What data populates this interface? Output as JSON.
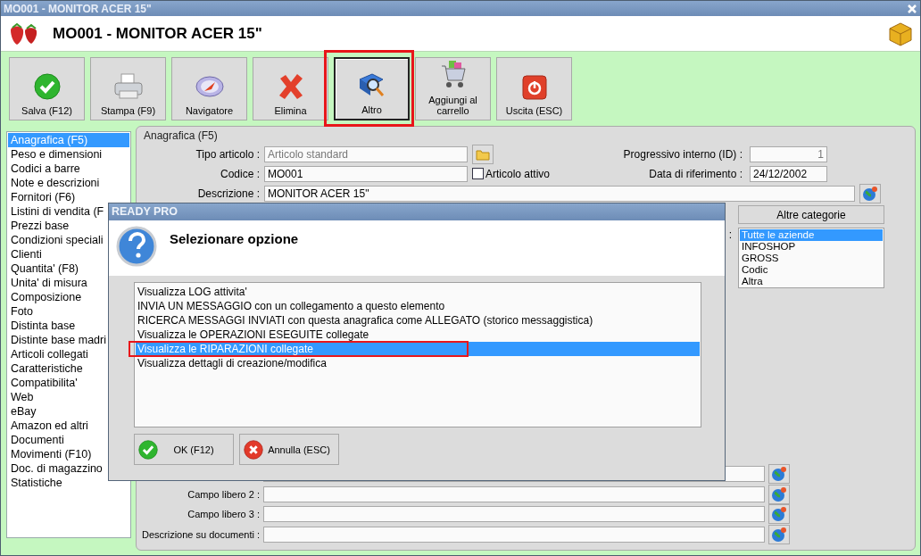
{
  "window": {
    "title": "MO001 - MONITOR ACER 15\""
  },
  "header": {
    "title": "MO001 - MONITOR ACER 15\""
  },
  "toolbar": [
    {
      "label": "Salva (F12)",
      "selected": false
    },
    {
      "label": "Stampa (F9)",
      "selected": false
    },
    {
      "label": "Navigatore",
      "selected": false
    },
    {
      "label": "Elimina",
      "selected": false
    },
    {
      "label": "Altro",
      "selected": true,
      "highlighted": true
    },
    {
      "label": "Aggiungi al carrello",
      "selected": false
    },
    {
      "label": "Uscita (ESC)",
      "selected": false
    }
  ],
  "sidebar": {
    "items": [
      {
        "label": "Anagrafica (F5)",
        "selected": true
      },
      {
        "label": "Peso e dimensioni",
        "selected": false
      },
      {
        "label": "Codici a barre",
        "selected": false
      },
      {
        "label": "Note e descrizioni",
        "selected": false
      },
      {
        "label": "Fornitori (F6)",
        "selected": false
      },
      {
        "label": "Listini di vendita (F",
        "selected": false
      },
      {
        "label": "Prezzi base",
        "selected": false
      },
      {
        "label": "Condizioni speciali",
        "selected": false
      },
      {
        "label": "Clienti",
        "selected": false
      },
      {
        "label": "Quantita' (F8)",
        "selected": false
      },
      {
        "label": "Unita' di misura",
        "selected": false
      },
      {
        "label": "Composizione",
        "selected": false
      },
      {
        "label": "Foto",
        "selected": false
      },
      {
        "label": "Distinta base",
        "selected": false
      },
      {
        "label": "Distinte base madri",
        "selected": false
      },
      {
        "label": "Articoli collegati",
        "selected": false
      },
      {
        "label": "Caratteristiche",
        "selected": false
      },
      {
        "label": "Compatibilita'",
        "selected": false
      },
      {
        "label": "Web",
        "selected": false
      },
      {
        "label": "eBay",
        "selected": false
      },
      {
        "label": "Amazon ed altri",
        "selected": false
      },
      {
        "label": "Documenti",
        "selected": false
      },
      {
        "label": "Movimenti (F10)",
        "selected": false
      },
      {
        "label": "Doc. di magazzino",
        "selected": false
      },
      {
        "label": "Statistiche",
        "selected": false
      }
    ]
  },
  "form": {
    "legend": "Anagrafica (F5)",
    "tipo_articolo": {
      "label": "Tipo articolo :",
      "value": "Articolo standard",
      "disabled": true
    },
    "codice": {
      "label": "Codice :",
      "value": "MO001"
    },
    "articolo_attivo": {
      "label": "Articolo attivo",
      "checked": false
    },
    "progressivo": {
      "label": "Progressivo interno (ID) :",
      "value": "1",
      "disabled": true
    },
    "data_riferimento": {
      "label": "Data di riferimento :",
      "value": "24/12/2002"
    },
    "descrizione": {
      "label": "Descrizione :",
      "value": "MONITOR ACER 15\""
    },
    "altre_categorie_button": "Altre categorie",
    "companies_colon": ":",
    "companies": [
      {
        "label": "Tutte le aziende",
        "selected": true
      },
      {
        "label": "INFOSHOP",
        "selected": false
      },
      {
        "label": "GROSS",
        "selected": false
      },
      {
        "label": "Codic",
        "selected": false
      },
      {
        "label": "Altra",
        "selected": false
      }
    ],
    "extra_fields": [
      {
        "label": "Campo libero 2 :"
      },
      {
        "label": "Campo libero 3 :"
      },
      {
        "label": "Descrizione su documenti :"
      }
    ]
  },
  "dialog": {
    "title": "READY PRO",
    "heading": "Selezionare opzione",
    "options": [
      {
        "label": "Visualizza LOG attivita'",
        "selected": false
      },
      {
        "label": "INVIA UN MESSAGGIO con un collegamento a questo elemento",
        "selected": false
      },
      {
        "label": "RICERCA MESSAGGI INVIATI con questa anagrafica come ALLEGATO (storico messaggistica)",
        "selected": false
      },
      {
        "label": "Visualizza le OPERAZIONI ESEGUITE collegate",
        "selected": false
      },
      {
        "label": "Visualizza le RIPARAZIONI collegate",
        "selected": true,
        "highlighted": true
      },
      {
        "label": "Visualizza dettagli di creazione/modifica",
        "selected": false
      }
    ],
    "buttons": [
      {
        "label": "OK (F12)"
      },
      {
        "label": "Annulla (ESC)"
      }
    ]
  }
}
